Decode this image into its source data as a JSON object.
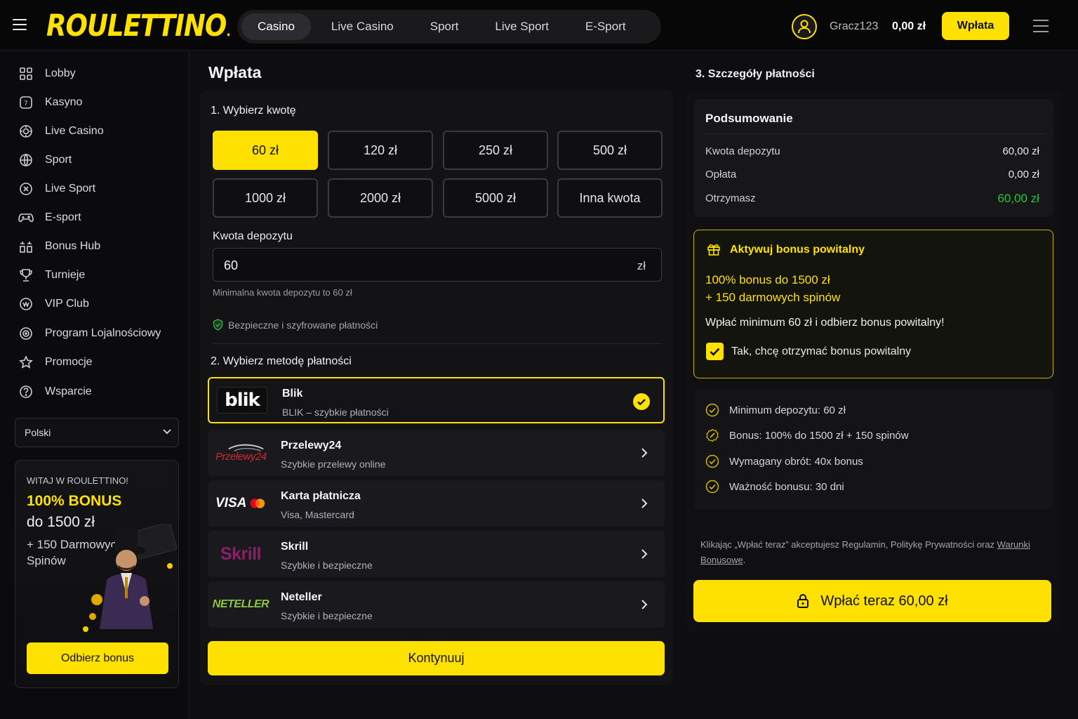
{
  "header": {
    "logo": "ROULETTINO",
    "nav": [
      "Casino",
      "Live Casino",
      "Sport",
      "Live Sport",
      "E-Sport"
    ],
    "active_nav": "Casino",
    "username": "Gracz123",
    "balance": "0,00 zł",
    "deposit_button": "Wpłata"
  },
  "sidebar": {
    "items": [
      {
        "label": "Lobby",
        "icon": "grid-icon"
      },
      {
        "label": "Kasyno",
        "icon": "slot-icon"
      },
      {
        "label": "Live Casino",
        "icon": "chip-icon"
      },
      {
        "label": "Sport",
        "icon": "ball-icon"
      },
      {
        "label": "Live Sport",
        "icon": "x-circle-icon"
      },
      {
        "label": "E-sport",
        "icon": "gamepad-icon"
      },
      {
        "label": "Bonus Hub",
        "icon": "bonus-hub-icon"
      },
      {
        "label": "Turnieje",
        "icon": "trophy-icon"
      },
      {
        "label": "VIP Club",
        "icon": "vip-icon"
      },
      {
        "label": "Program Lojalnościowy",
        "icon": "loyalty-icon"
      },
      {
        "label": "Promocje",
        "icon": "star-icon"
      },
      {
        "label": "Wsparcie",
        "icon": "help-icon"
      }
    ],
    "language": "Polski",
    "promo": {
      "welcome": "WITAJ W ROULETTINO!",
      "bonus": "100% BONUS",
      "amount": "do 1500 zł",
      "spins": "+ 150 Darmowych Spinów",
      "button": "Odbierz bonus"
    }
  },
  "main": {
    "title": "Wpłata",
    "step1": "1. Wybierz kwotę",
    "amounts": [
      "60 zł",
      "120 zł",
      "250 zł",
      "500 zł",
      "1000 zł",
      "2000 zł",
      "5000 zł",
      "Inna kwota"
    ],
    "selected_amount": "60 zł",
    "field_label": "Kwota depozytu",
    "field_value": "60",
    "currency": "zł",
    "hint": "Minimalna kwota depozytu to 60 zł",
    "secure": "Bezpieczne i szyfrowane płatności",
    "step2": "2. Wybierz metodę płatności",
    "methods": [
      {
        "name": "Blik",
        "sub": "BLIK – szybkie płatności",
        "logo": "blik"
      },
      {
        "name": "Przelewy24",
        "sub": "Szybkie przelewy online",
        "logo": "Przelewy24"
      },
      {
        "name": "Karta płatnicza",
        "sub": "Visa, Mastercard",
        "logo": "VISA"
      },
      {
        "name": "Skrill",
        "sub": "Szybkie i bezpieczne",
        "logo": "Skrill"
      },
      {
        "name": "Neteller",
        "sub": "Szybkie i bezpieczne",
        "logo": "NETELLER"
      }
    ],
    "continue": "Kontynuuj"
  },
  "right": {
    "title": "3. Szczegóły płatności",
    "summary_title": "Podsumowanie",
    "rows": [
      {
        "label": "Kwota depozytu",
        "value": "60,00 zł"
      },
      {
        "label": "Opłata",
        "value": "0,00 zł"
      },
      {
        "label": "Otrzymasz",
        "value": "60,00 zł"
      }
    ],
    "bonus": {
      "title": "Aktywuj bonus powitalny",
      "line1": "100% bonus do 1500 zł",
      "line2": "+ 150 darmowych spinów",
      "desc": "Wpłać minimum 60 zł i odbierz bonus powitalny!",
      "checkbox": "Tak, chcę otrzymać bonus powitalny",
      "checked": true
    },
    "info": [
      "Minimum depozytu: 60 zł",
      "Bonus: 100% do 1500 zł + 150 spinów",
      "Wymagany obrót: 40x bonus",
      "Ważność bonusu: 30 dni"
    ],
    "terms_prefix": "Klikając „Wpłać teraz” akceptujesz Regulamin, Politykę Prywatności oraz ",
    "terms_link": "Warunki Bonusowe",
    "terms_suffix": ".",
    "pay_button": "Wpłać teraz 60,00 zł"
  },
  "colors": {
    "accent": "#ffe100",
    "green": "#27c43a",
    "background": "#0e0e10"
  }
}
